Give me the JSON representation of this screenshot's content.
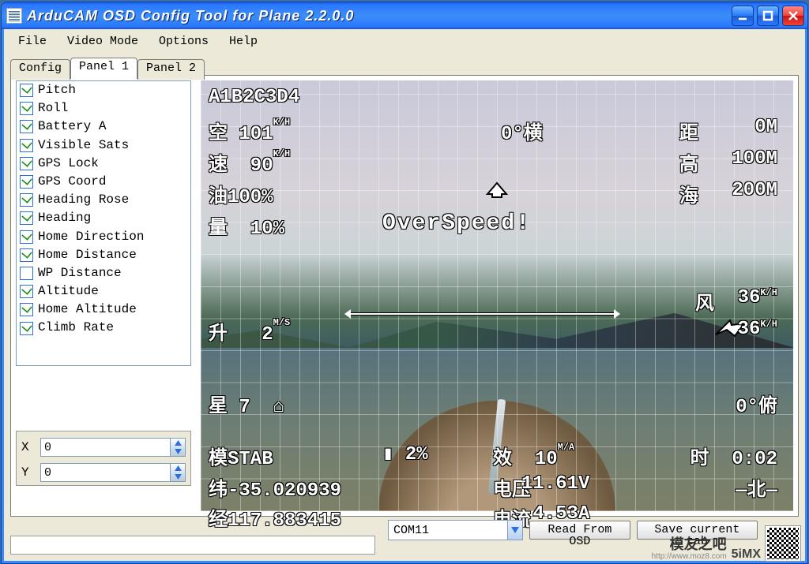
{
  "window": {
    "title": "ArduCAM OSD Config Tool for Plane 2.2.0.0"
  },
  "menu": [
    "File",
    "Video Mode",
    "Options",
    "Help"
  ],
  "tabs": [
    {
      "label": "Config",
      "active": false
    },
    {
      "label": "Panel 1",
      "active": true
    },
    {
      "label": "Panel 2",
      "active": false
    }
  ],
  "panel_items": [
    {
      "label": "Pitch",
      "checked": true
    },
    {
      "label": "Roll",
      "checked": true
    },
    {
      "label": "Battery A",
      "checked": true
    },
    {
      "label": "Visible Sats",
      "checked": true
    },
    {
      "label": "GPS Lock",
      "checked": true
    },
    {
      "label": "GPS Coord",
      "checked": true
    },
    {
      "label": "Heading Rose",
      "checked": true
    },
    {
      "label": "Heading",
      "checked": true
    },
    {
      "label": "Home Direction",
      "checked": true
    },
    {
      "label": "Home Distance",
      "checked": true
    },
    {
      "label": "WP Distance",
      "checked": false
    },
    {
      "label": "Altitude",
      "checked": true
    },
    {
      "label": "Home Altitude",
      "checked": true
    },
    {
      "label": "Climb Rate",
      "checked": true
    }
  ],
  "xy": {
    "x_label": "X",
    "y_label": "Y",
    "x": "0",
    "y": "0"
  },
  "osd": {
    "char_test": "A1B2C3D4",
    "air_label": "空",
    "air_val": "101",
    "air_unit": "K/H",
    "spd_label": "速",
    "spd_val": " 90",
    "spd_unit": "K/H",
    "thr_label": "油",
    "thr_val": "100%",
    "rssi_label": "量",
    "rssi_val": " 10%",
    "roll_val": "0°横",
    "dist_label": "距",
    "dist_val": "  0M",
    "alt_label": "高",
    "alt_val": "100M",
    "altsea_label": "海",
    "altsea_val": "200M",
    "warn": "OverSpeed!",
    "climb_label": "升",
    "climb_val": " 2",
    "climb_unit": "M/S",
    "wind_val": "36",
    "wind_unit": "K/H",
    "gspd_val": "36",
    "gspd_unit": "K/H",
    "sats_label": "星",
    "sats_val": "7",
    "pitch_val": "0°俯",
    "mode_label": "模",
    "mode_val": "STAB",
    "batt_pct": " 2%",
    "eff_label": "效",
    "eff_val": "10",
    "eff_unit": "M/A",
    "time_label": "时",
    "time_val": "0:02",
    "lat_label": "纬",
    "lat_val": "-35.020939",
    "volt_label": "电压",
    "volt_val": "11.61V",
    "lon_label": "经",
    "lon_val": "117.883415",
    "amp_label": "电流",
    "amp_val": " 4.53A",
    "north_label": "北",
    "lock_icon": "⌂"
  },
  "bottom": {
    "com_selected": "COM11",
    "btn_read": "Read From OSD",
    "btn_save": "Save current tab"
  },
  "watermark": {
    "brand": "模友之吧",
    "sub": "5iMX",
    "url": "http://www.moz8.com"
  }
}
